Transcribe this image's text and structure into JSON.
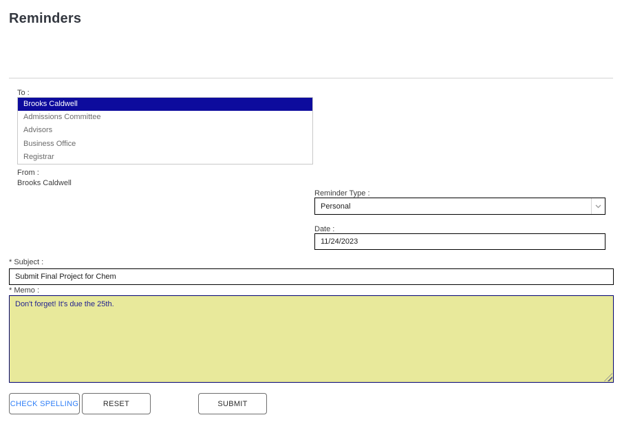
{
  "page": {
    "title": "Reminders"
  },
  "to_list": {
    "label": "To :",
    "options": [
      "Brooks Caldwell",
      "Admissions Committee",
      "Advisors",
      "Business Office",
      "Registrar"
    ],
    "selected_index": 0
  },
  "from": {
    "label": "From :",
    "value": "Brooks Caldwell"
  },
  "reminder_type": {
    "label": "Reminder Type :",
    "value": "Personal"
  },
  "date": {
    "label": "Date :",
    "value": "11/24/2023"
  },
  "subject": {
    "label": "* Subject :",
    "value": "Submit Final Project for Chem"
  },
  "memo": {
    "label": "* Memo :",
    "value": "Don't forget! It's due the 25th."
  },
  "buttons": {
    "check_spelling": "CHECK SPELLING",
    "reset": "RESET",
    "submit": "SUBMIT"
  },
  "colors": {
    "title_text": "#343840",
    "label_text": "#3d3d3d",
    "option_text": "#6b6b6b",
    "selection_bg": "#0d0b9d",
    "selection_text": "#ffffff",
    "listbox_border": "#c8c8c8",
    "input_border": "#000000",
    "memo_bg": "#e8e99b",
    "memo_border": "#000070",
    "memo_text": "#1f1f8f",
    "link_blue": "#2e7ef7",
    "button_border": "#6e6e6e",
    "divider": "#d3d3d3"
  }
}
